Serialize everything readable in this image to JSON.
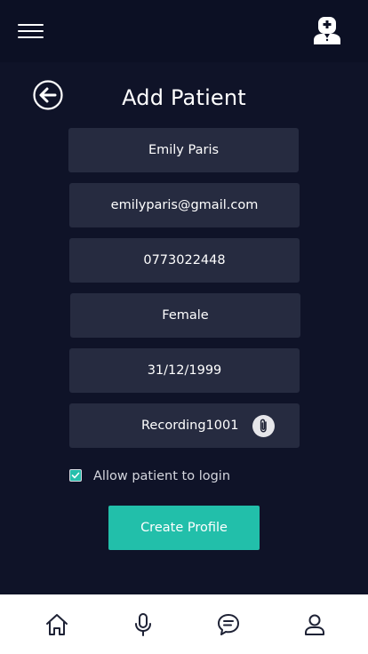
{
  "header": {
    "menu_icon": "hamburger-menu-icon",
    "doctor_icon": "doctor-icon"
  },
  "page": {
    "back_icon": "back-arrow-icon",
    "title": "Add Patient"
  },
  "form": {
    "name": "Emily Paris",
    "email": "emilyparis@gmail.com",
    "phone": "0773022448",
    "gender": "Female",
    "dob": "31/12/1999",
    "recording": "Recording1001",
    "attach_icon": "paperclip-icon",
    "allow_login_checked": true,
    "allow_login_label": "Allow patient to login",
    "submit_label": "Create Profile"
  },
  "bottom_nav": {
    "items": [
      {
        "icon": "home-icon"
      },
      {
        "icon": "microphone-icon"
      },
      {
        "icon": "chat-icon"
      },
      {
        "icon": "user-icon"
      }
    ]
  },
  "colors": {
    "background": "#0f1328",
    "header": "#0c1024",
    "field": "#262b40",
    "accent": "#22bfaa",
    "nav_background": "#ffffff",
    "nav_icon": "#1e2235"
  }
}
